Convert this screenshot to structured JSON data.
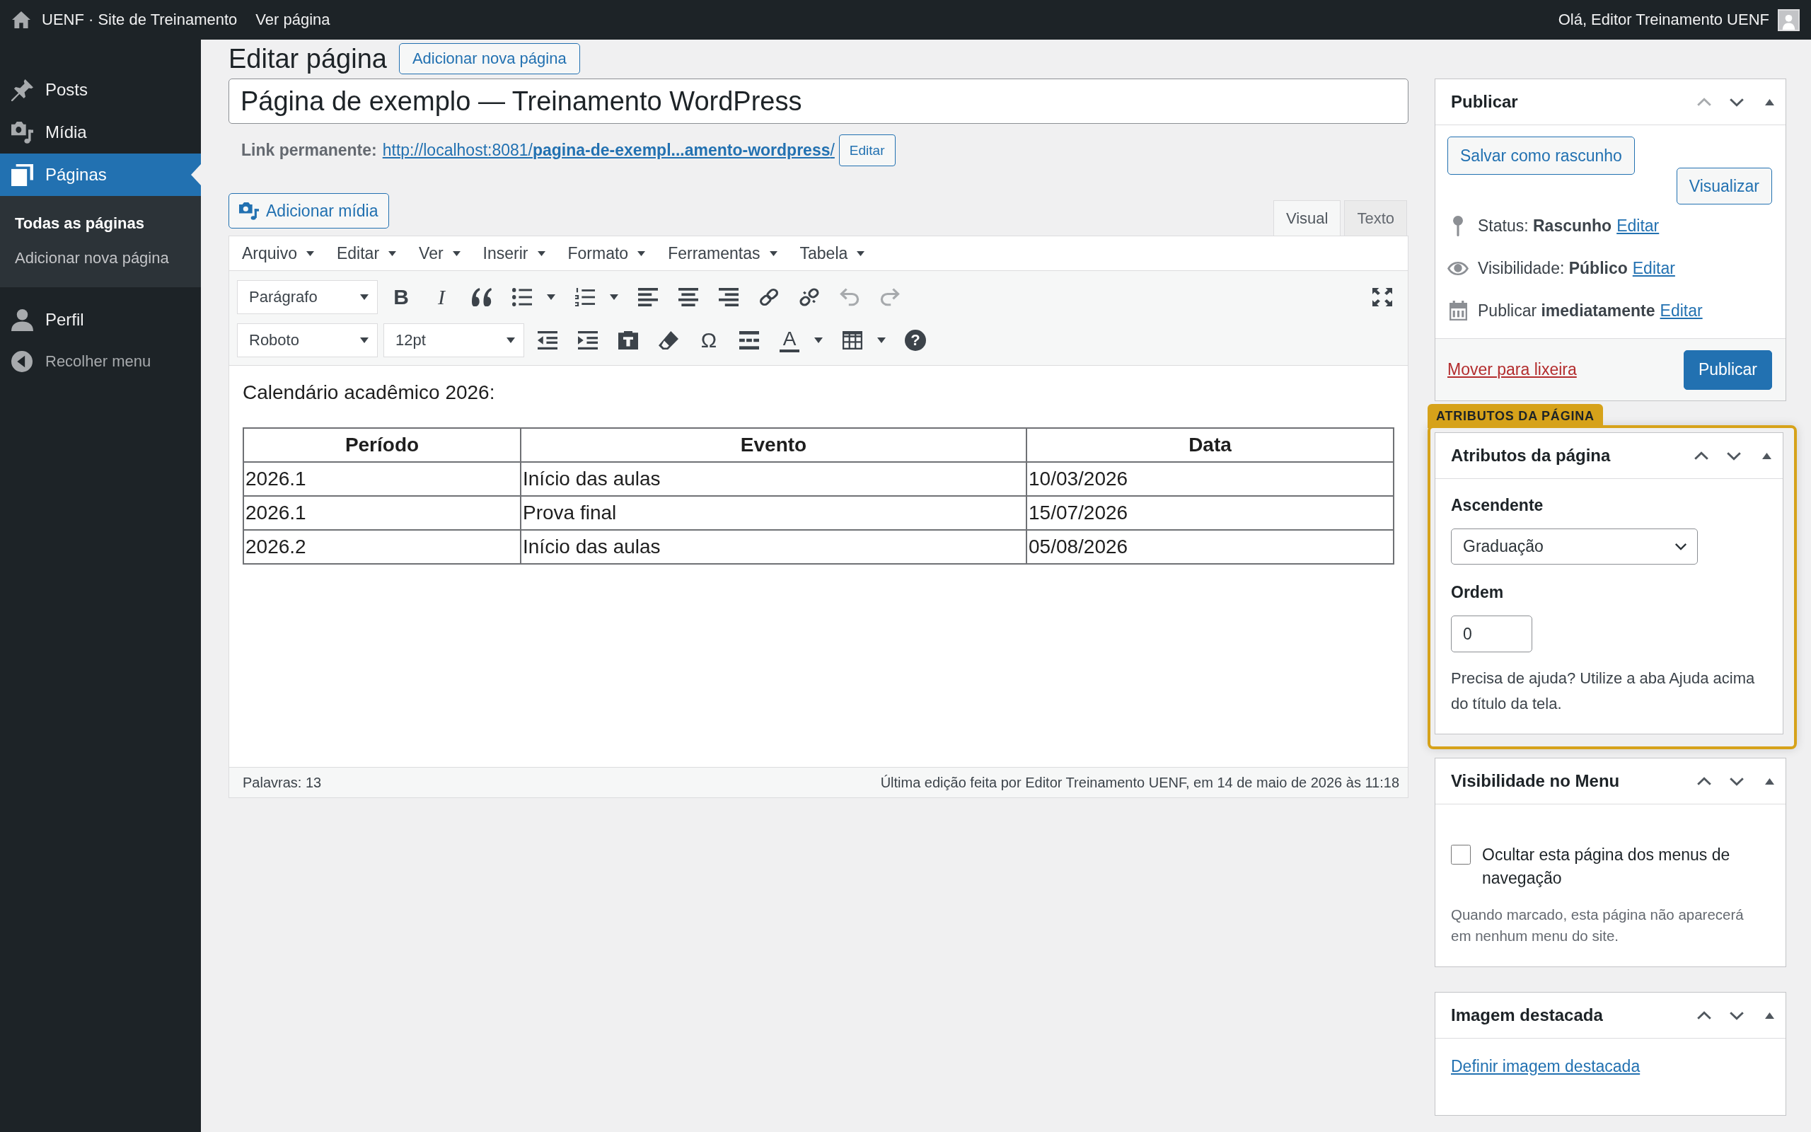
{
  "admin_bar": {
    "site_name": "UENF · Site de Treinamento",
    "view_page": "Ver página",
    "greeting": "Olá, Editor Treinamento UENF"
  },
  "sidebar": {
    "items": [
      {
        "label": "Posts",
        "selected": false
      },
      {
        "label": "Mídia",
        "selected": false
      },
      {
        "label": "Páginas",
        "selected": true,
        "children": [
          {
            "label": "Todas as páginas",
            "selected": true
          },
          {
            "label": "Adicionar nova página",
            "selected": false
          }
        ]
      },
      {
        "label": "Perfil",
        "selected": false
      }
    ],
    "collapse": "Recolher menu"
  },
  "page_header": {
    "title": "Editar página",
    "add_new": "Adicionar nova página"
  },
  "editor": {
    "post_title": "Página de exemplo — Treinamento WordPress",
    "permalink": {
      "label": "Link permanente:",
      "url": "http://localhost:8081/**pagina-de-exempl...amento-wordpress**/",
      "edit_button": "Editar"
    },
    "add_media": "Adicionar mídia",
    "tabs": [
      {
        "label": "Visual",
        "selected": true
      },
      {
        "label": "Texto",
        "selected": false
      }
    ],
    "menu_bar": [
      "Arquivo",
      "Editar",
      "Ver",
      "Inserir",
      "Formato",
      "Ferramentas",
      "Tabela"
    ],
    "toolbar": [
      {
        "items": [
          {
            "kind": "select",
            "value": "Parágrafo",
            "disabled": false
          },
          {
            "kind": "char",
            "text": "B",
            "bold": true,
            "italic": false,
            "disabled": false
          },
          {
            "kind": "char",
            "text": "I",
            "bold": false,
            "italic": true,
            "disabled": false
          },
          {
            "kind": "icon",
            "disabled": false
          },
          {
            "kind": "split",
            "disabled": false
          },
          {
            "kind": "split",
            "disabled": false
          },
          {
            "kind": "icon",
            "disabled": false
          },
          {
            "kind": "icon",
            "disabled": false
          },
          {
            "kind": "icon",
            "disabled": false
          },
          {
            "kind": "icon",
            "disabled": false
          },
          {
            "kind": "icon",
            "disabled": false
          },
          {
            "kind": "icon",
            "disabled": true
          },
          {
            "kind": "icon",
            "disabled": true
          }
        ],
        "trailing": [
          {
            "kind": "icon",
            "disabled": false
          }
        ]
      },
      {
        "items": [
          {
            "kind": "select",
            "value": "Roboto",
            "disabled": false
          },
          {
            "kind": "select",
            "value": "12pt",
            "disabled": false
          },
          {
            "kind": "icon",
            "disabled": false
          },
          {
            "kind": "icon",
            "disabled": false
          },
          {
            "kind": "icon",
            "disabled": false
          },
          {
            "kind": "icon",
            "disabled": false
          },
          {
            "kind": "char",
            "text": "Ω",
            "bold": false,
            "italic": false,
            "disabled": false
          },
          {
            "kind": "icon",
            "disabled": false
          },
          {
            "kind": "textcolor",
            "text": "A",
            "disabled": false
          },
          {
            "kind": "split",
            "disabled": false
          },
          {
            "kind": "help",
            "text": "?",
            "disabled": false
          }
        ]
      }
    ],
    "content": {
      "paragraph": "Calendário acadêmico 2026:",
      "table": {
        "columns": [
          "Período",
          "Evento",
          "Data"
        ],
        "rows": [
          [
            "2026.1",
            "Início das aulas",
            "10/03/2026"
          ],
          [
            "2026.1",
            "Prova final",
            "15/07/2026"
          ],
          [
            "2026.2",
            "Início das aulas",
            "05/08/2026"
          ]
        ]
      }
    },
    "status_bar": {
      "word_count": "Palavras: 13",
      "last_edit": "Última edição feita por Editor Treinamento UENF, em 14 de maio de 2026 às 11:18"
    }
  },
  "meta_boxes": [
    {
      "kind": "publish",
      "title": "Publicar",
      "up_disabled": true,
      "save_draft": "Salvar como rascunho",
      "preview": "Visualizar",
      "rows": [
        {
          "text": "Status: **Rascunho**",
          "link": "Editar"
        },
        {
          "text": "Visibilidade: **Público**",
          "link": "Editar"
        },
        {
          "text": "Publicar **imediatamente**",
          "link": "Editar"
        }
      ],
      "trash": "Mover para lixeira",
      "publish": "Publicar"
    },
    {
      "kind": "attributes",
      "title": "Atributos da página",
      "up_disabled": false,
      "highlighted": true,
      "highlight_label": "ATRIBUTOS DA PÁGINA",
      "parent_label": "Ascendente",
      "parent_value": "Graduação",
      "order_label": "Ordem",
      "order_value": "0",
      "help": "Precisa de ajuda? Utilize a aba Ajuda acima do título da tela."
    },
    {
      "kind": "menu_visibility",
      "title": "Visibilidade no Menu",
      "up_disabled": false,
      "checkbox_label": "Ocultar esta página dos menus de navegação",
      "checked": false,
      "description": "Quando marcado, esta página não aparecerá em nenhum menu do site."
    },
    {
      "kind": "featured_image",
      "title": "Imagem destacada",
      "up_disabled": false,
      "link": "Definir imagem destacada"
    }
  ]
}
